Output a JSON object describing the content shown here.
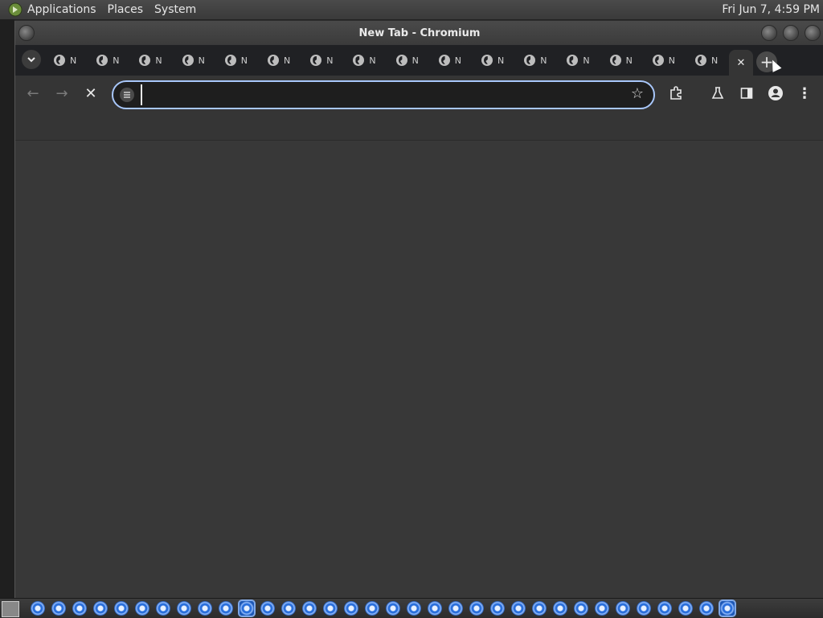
{
  "top_panel": {
    "menus": [
      "Applications",
      "Places",
      "System"
    ],
    "clock": "Fri Jun  7,  4:59 PM"
  },
  "window": {
    "title": "New Tab - Chromium"
  },
  "tabs": {
    "count_inactive": 16,
    "inactive_label": "N",
    "active_close": "✕",
    "new_tab": "+"
  },
  "toolbar": {
    "back": "←",
    "forward": "→",
    "stop": "✕",
    "omnibox_value": "",
    "star": "☆",
    "extensions": "extensions-icon",
    "labs": "flask-icon",
    "side_panel": "side-panel-icon",
    "profile": "profile-icon",
    "menu": "⋮"
  },
  "taskbar": {
    "task_count": 34
  },
  "colors": {
    "omnibox_border": "#a8c7fa",
    "tab_strip": "#202124",
    "content_bg": "#383838"
  }
}
